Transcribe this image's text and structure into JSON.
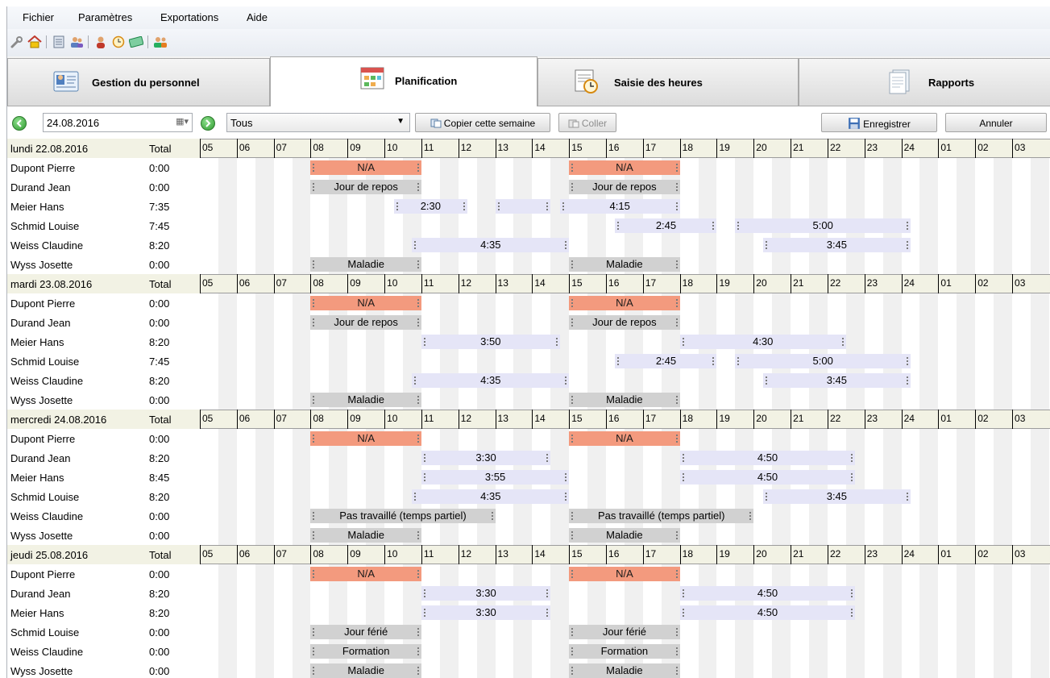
{
  "menu": [
    "Fichier",
    "Paramètres",
    "Exportations",
    "Aide"
  ],
  "toolbar_icons": [
    "wrench-icon",
    "home-icon",
    "list-icon",
    "users-icon",
    "person-icon",
    "clock-icon",
    "money-icon",
    "group-icon"
  ],
  "tabs": [
    {
      "label": "Gestion du personnel",
      "icon": "staff-card-icon",
      "active": false
    },
    {
      "label": "Planification",
      "icon": "planning-grid-icon",
      "active": true
    },
    {
      "label": "Saisie des heures",
      "icon": "timesheet-clock-icon",
      "active": false
    },
    {
      "label": "Rapports",
      "icon": "reports-icon",
      "active": false
    }
  ],
  "filter": {
    "date": "24.08.2016",
    "group": "Tous",
    "copy_week": "Copier cette semaine",
    "paste": "Coller",
    "save": "Enregistrer",
    "cancel": "Annuler"
  },
  "hours": [
    "05",
    "06",
    "07",
    "08",
    "09",
    "10",
    "11",
    "12",
    "13",
    "14",
    "15",
    "16",
    "17",
    "18",
    "19",
    "20",
    "21",
    "22",
    "23",
    "24",
    "01",
    "02",
    "03"
  ],
  "total_label": "Total",
  "days": [
    {
      "label": "lundi 22.08.2016",
      "employees": [
        {
          "name": "Dupont Pierre",
          "total": "0:00",
          "blocks": [
            {
              "type": "na",
              "start": 8,
              "end": 11,
              "label": "N/A"
            },
            {
              "type": "na",
              "start": 15,
              "end": 18,
              "label": "N/A"
            }
          ]
        },
        {
          "name": "Durand Jean",
          "total": "0:00",
          "blocks": [
            {
              "type": "off",
              "start": 8,
              "end": 11,
              "label": "Jour de repos"
            },
            {
              "type": "off",
              "start": 15,
              "end": 18,
              "label": "Jour de repos"
            }
          ]
        },
        {
          "name": "Meier Hans",
          "total": "7:35",
          "blocks": [
            {
              "type": "work",
              "start": 10.25,
              "end": 12.25,
              "label": "2:30"
            },
            {
              "type": "work",
              "start": 13,
              "end": 14.5,
              "label": ""
            },
            {
              "type": "work",
              "start": 14.75,
              "end": 18,
              "label": "4:15"
            }
          ]
        },
        {
          "name": "Schmid Louise",
          "total": "7:45",
          "blocks": [
            {
              "type": "work",
              "start": 16.25,
              "end": 19,
              "label": "2:45"
            },
            {
              "type": "work",
              "start": 19.5,
              "end": 24.25,
              "label": "5:00"
            }
          ]
        },
        {
          "name": "Weiss Claudine",
          "total": "8:20",
          "blocks": [
            {
              "type": "work",
              "start": 10.75,
              "end": 15,
              "label": "4:35"
            },
            {
              "type": "work",
              "start": 20.25,
              "end": 24.25,
              "label": "3:45"
            }
          ]
        },
        {
          "name": "Wyss Josette",
          "total": "0:00",
          "blocks": [
            {
              "type": "off",
              "start": 8,
              "end": 11,
              "label": "Maladie"
            },
            {
              "type": "off",
              "start": 15,
              "end": 18,
              "label": "Maladie"
            }
          ]
        }
      ]
    },
    {
      "label": "mardi 23.08.2016",
      "employees": [
        {
          "name": "Dupont Pierre",
          "total": "0:00",
          "blocks": [
            {
              "type": "na",
              "start": 8,
              "end": 11,
              "label": "N/A"
            },
            {
              "type": "na",
              "start": 15,
              "end": 18,
              "label": "N/A"
            }
          ]
        },
        {
          "name": "Durand Jean",
          "total": "0:00",
          "blocks": [
            {
              "type": "off",
              "start": 8,
              "end": 11,
              "label": "Jour de repos"
            },
            {
              "type": "off",
              "start": 15,
              "end": 18,
              "label": "Jour de repos"
            }
          ]
        },
        {
          "name": "Meier Hans",
          "total": "8:20",
          "blocks": [
            {
              "type": "work",
              "start": 11,
              "end": 14.75,
              "label": "3:50"
            },
            {
              "type": "work",
              "start": 18,
              "end": 22.5,
              "label": "4:30"
            }
          ]
        },
        {
          "name": "Schmid Louise",
          "total": "7:45",
          "blocks": [
            {
              "type": "work",
              "start": 16.25,
              "end": 19,
              "label": "2:45"
            },
            {
              "type": "work",
              "start": 19.5,
              "end": 24.25,
              "label": "5:00"
            }
          ]
        },
        {
          "name": "Weiss Claudine",
          "total": "8:20",
          "blocks": [
            {
              "type": "work",
              "start": 10.75,
              "end": 15,
              "label": "4:35"
            },
            {
              "type": "work",
              "start": 20.25,
              "end": 24.25,
              "label": "3:45"
            }
          ]
        },
        {
          "name": "Wyss Josette",
          "total": "0:00",
          "blocks": [
            {
              "type": "off",
              "start": 8,
              "end": 11,
              "label": "Maladie"
            },
            {
              "type": "off",
              "start": 15,
              "end": 18,
              "label": "Maladie"
            }
          ]
        }
      ]
    },
    {
      "label": "mercredi 24.08.2016",
      "employees": [
        {
          "name": "Dupont Pierre",
          "total": "0:00",
          "blocks": [
            {
              "type": "na",
              "start": 8,
              "end": 11,
              "label": "N/A"
            },
            {
              "type": "na",
              "start": 15,
              "end": 18,
              "label": "N/A"
            }
          ]
        },
        {
          "name": "Durand Jean",
          "total": "8:20",
          "blocks": [
            {
              "type": "work",
              "start": 11,
              "end": 14.5,
              "label": "3:30"
            },
            {
              "type": "work",
              "start": 18,
              "end": 22.75,
              "label": "4:50"
            }
          ]
        },
        {
          "name": "Meier Hans",
          "total": "8:45",
          "blocks": [
            {
              "type": "work",
              "start": 11,
              "end": 15,
              "label": "3:55"
            },
            {
              "type": "work",
              "start": 18,
              "end": 22.75,
              "label": "4:50"
            }
          ]
        },
        {
          "name": "Schmid Louise",
          "total": "8:20",
          "blocks": [
            {
              "type": "work",
              "start": 10.75,
              "end": 15,
              "label": "4:35"
            },
            {
              "type": "work",
              "start": 20.25,
              "end": 24.25,
              "label": "3:45"
            }
          ]
        },
        {
          "name": "Weiss Claudine",
          "total": "0:00",
          "blocks": [
            {
              "type": "off",
              "start": 8,
              "end": 13,
              "label": "Pas travaillé (temps partiel)"
            },
            {
              "type": "off",
              "start": 15,
              "end": 20,
              "label": "Pas travaillé (temps partiel)"
            }
          ]
        },
        {
          "name": "Wyss Josette",
          "total": "0:00",
          "blocks": [
            {
              "type": "off",
              "start": 8,
              "end": 11,
              "label": "Maladie"
            },
            {
              "type": "off",
              "start": 15,
              "end": 18,
              "label": "Maladie"
            }
          ]
        }
      ]
    },
    {
      "label": "jeudi 25.08.2016",
      "employees": [
        {
          "name": "Dupont Pierre",
          "total": "0:00",
          "blocks": [
            {
              "type": "na",
              "start": 8,
              "end": 11,
              "label": "N/A"
            },
            {
              "type": "na",
              "start": 15,
              "end": 18,
              "label": "N/A"
            }
          ]
        },
        {
          "name": "Durand Jean",
          "total": "8:20",
          "blocks": [
            {
              "type": "work",
              "start": 11,
              "end": 14.5,
              "label": "3:30"
            },
            {
              "type": "work",
              "start": 18,
              "end": 22.75,
              "label": "4:50"
            }
          ]
        },
        {
          "name": "Meier Hans",
          "total": "8:20",
          "blocks": [
            {
              "type": "work",
              "start": 11,
              "end": 14.5,
              "label": "3:30"
            },
            {
              "type": "work",
              "start": 18,
              "end": 22.75,
              "label": "4:50"
            }
          ]
        },
        {
          "name": "Schmid Louise",
          "total": "0:00",
          "blocks": [
            {
              "type": "off",
              "start": 8,
              "end": 11,
              "label": "Jour férié"
            },
            {
              "type": "off",
              "start": 15,
              "end": 18,
              "label": "Jour férié"
            }
          ]
        },
        {
          "name": "Weiss Claudine",
          "total": "0:00",
          "blocks": [
            {
              "type": "off",
              "start": 8,
              "end": 11,
              "label": "Formation"
            },
            {
              "type": "off",
              "start": 15,
              "end": 18,
              "label": "Formation"
            }
          ]
        },
        {
          "name": "Wyss Josette",
          "total": "0:00",
          "blocks": [
            {
              "type": "off",
              "start": 8,
              "end": 11,
              "label": "Maladie"
            },
            {
              "type": "off",
              "start": 15,
              "end": 18,
              "label": "Maladie"
            }
          ]
        }
      ]
    }
  ]
}
